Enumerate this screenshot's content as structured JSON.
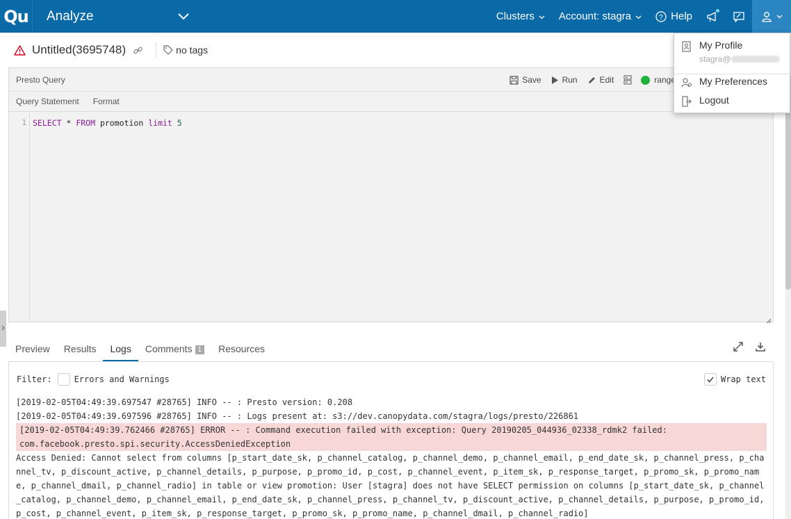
{
  "nav": {
    "logo": "Qu",
    "app": "Analyze",
    "clusters": "Clusters",
    "account": "Account: stagra",
    "help": "Help"
  },
  "query": {
    "title": "Untitled(3695748)",
    "tags": "no tags",
    "type": "Presto Query",
    "save": "Save",
    "run": "Run",
    "edit": "Edit",
    "cluster": "range",
    "subtabs": [
      "Query Statement",
      "Format"
    ],
    "line_number": "1",
    "code": {
      "select": "SELECT",
      "star": " * ",
      "from": "FROM",
      "table": " promotion ",
      "limit": "limit",
      "n": " 5"
    }
  },
  "bottom": {
    "tabs": [
      "Preview",
      "Results",
      "Logs",
      "Comments",
      "Resources"
    ],
    "comments_count": "1",
    "active_tab": "Logs"
  },
  "logs": {
    "filter_label": "Filter:",
    "errors_label": "Errors and Warnings",
    "wrap_label": "Wrap text",
    "wrap_checked": true,
    "lines": [
      "[2019-02-05T04:49:39.697547 #28765] INFO -- : Presto version: 0.208",
      "[2019-02-05T04:49:39.697596 #28765] INFO -- : Logs present at: s3://dev.canopydata.com/stagra/logs/presto/226861"
    ],
    "error_line": "[2019-02-05T04:49:39.762466 #28765] ERROR -- : Command execution failed with exception: Query 20190205_044936_02338_rdmk2 failed: com.facebook.presto.spi.security.AccessDeniedException",
    "denied": "Access Denied: Cannot select from columns [p_start_date_sk, p_channel_catalog, p_channel_demo, p_channel_email, p_end_date_sk, p_channel_press, p_channel_tv, p_discount_active, p_channel_details, p_purpose, p_promo_id, p_cost, p_channel_event, p_item_sk, p_response_target, p_promo_sk, p_promo_name, p_channel_dmail, p_channel_radio] in table or view promotion: User [stagra] does not have SELECT permission on columns [p_start_date_sk, p_channel_catalog, p_channel_demo, p_channel_email, p_end_date_sk, p_channel_press, p_channel_tv, p_discount_active, p_channel_details, p_purpose, p_promo_id, p_cost, p_channel_event, p_item_sk, p_response_target, p_promo_sk, p_promo_name, p_channel_dmail, p_channel_radio]"
  },
  "menu": {
    "profile": "My Profile",
    "email_prefix": "stagra@",
    "preferences": "My Preferences",
    "logout": "Logout"
  },
  "colors": {
    "nav": "#0a6aa8",
    "error_bg": "#f8d7d7",
    "status_green": "#21b23b",
    "warning": "#d0021b"
  }
}
